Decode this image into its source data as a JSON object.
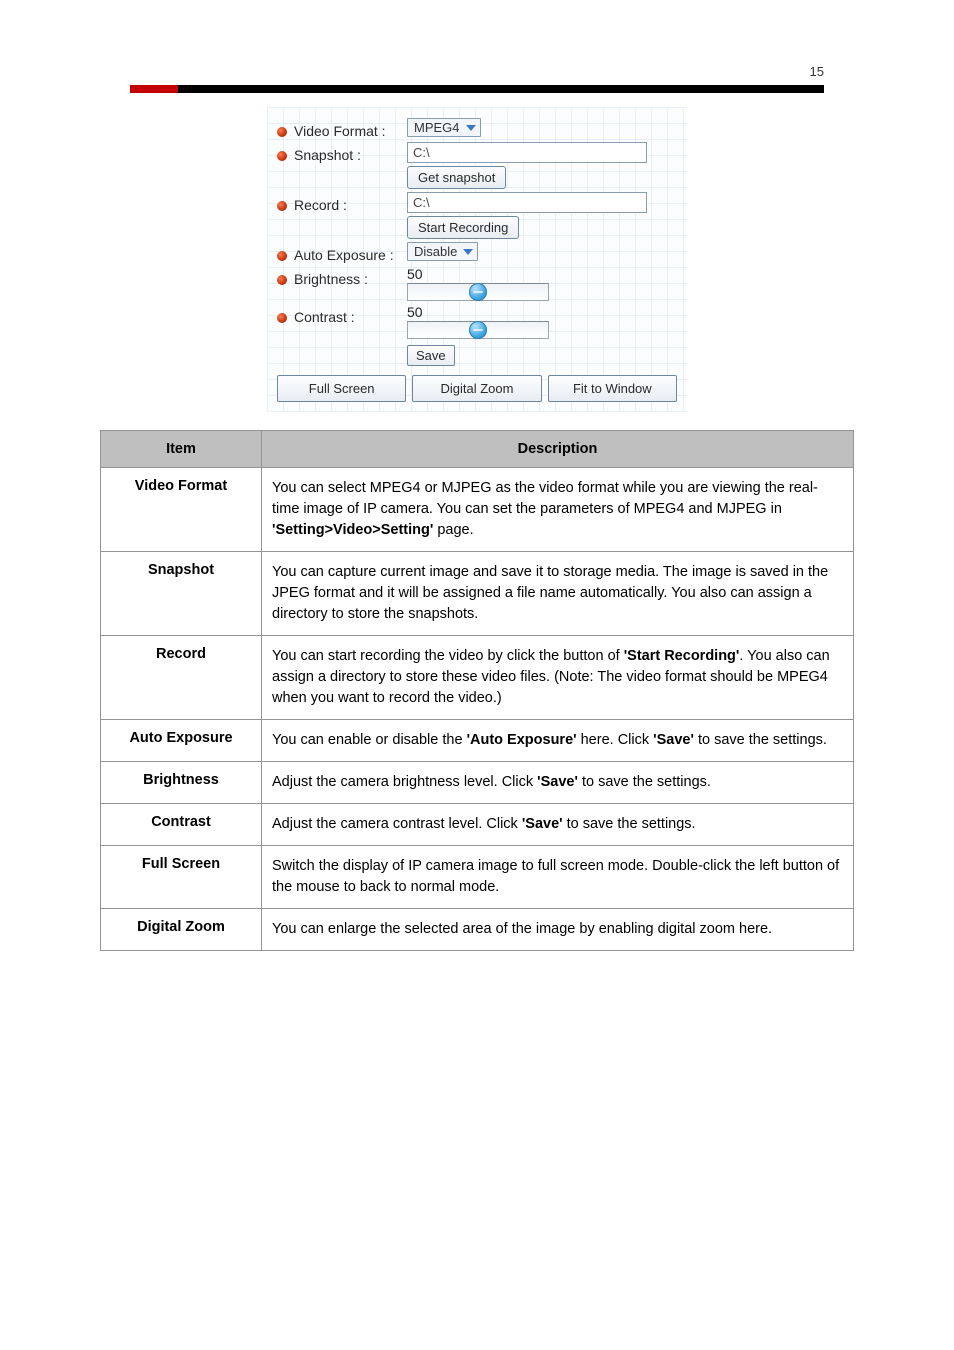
{
  "page_number": "15",
  "panel": {
    "video_format": {
      "label": "Video Format :",
      "value": "MPEG4"
    },
    "snapshot": {
      "label": "Snapshot :",
      "path": "C:\\",
      "button": "Get snapshot"
    },
    "record": {
      "label": "Record :",
      "path": "C:\\",
      "button": "Start Recording"
    },
    "auto_exposure": {
      "label": "Auto Exposure :",
      "value": "Disable"
    },
    "brightness": {
      "label": "Brightness :",
      "value": "50",
      "pct": 50
    },
    "contrast": {
      "label": "Contrast :",
      "value": "50",
      "pct": 50
    },
    "save_button": "Save",
    "buttons": [
      "Full Screen",
      "Digital Zoom",
      "Fit to Window"
    ]
  },
  "table": {
    "head": [
      "Item",
      "Description"
    ],
    "rows": [
      {
        "item": "Video Format",
        "desc": "You can select MPEG4 or MJPEG as the video format while you are viewing the real-time image of IP camera. You can set the parameters of MPEG4 and MJPEG in <b>'Setting>Video>Setting'</b> page."
      },
      {
        "item": "Snapshot",
        "desc": "You can capture current image and save it to storage media. The image is saved in the JPEG format and it will be assigned a file name automatically. You also can assign a directory to store the snapshots."
      },
      {
        "item": "Record",
        "desc": "You can start recording the video by click the button of <b>'Start Recording'</b>. You also can assign a directory to store these video files. (Note: The video format should be MPEG4 when you want to record the video.)"
      },
      {
        "item": "Auto Exposure",
        "desc": "You can enable or disable the <b>'Auto Exposure'</b> here. Click <b>'Save'</b> to save the settings."
      },
      {
        "item": "Brightness",
        "desc": "Adjust the camera brightness level. Click <b>'Save'</b> to save the settings."
      },
      {
        "item": "Contrast",
        "desc": "Adjust the camera contrast level. Click <b>'Save'</b> to save the settings."
      },
      {
        "item": "Full Screen",
        "desc": "Switch the display of IP camera image to full screen mode. Double-click the left button of the mouse to back to normal mode."
      },
      {
        "item": "Digital Zoom",
        "desc": "You can enlarge the selected area of the image by enabling digital zoom here."
      }
    ]
  }
}
